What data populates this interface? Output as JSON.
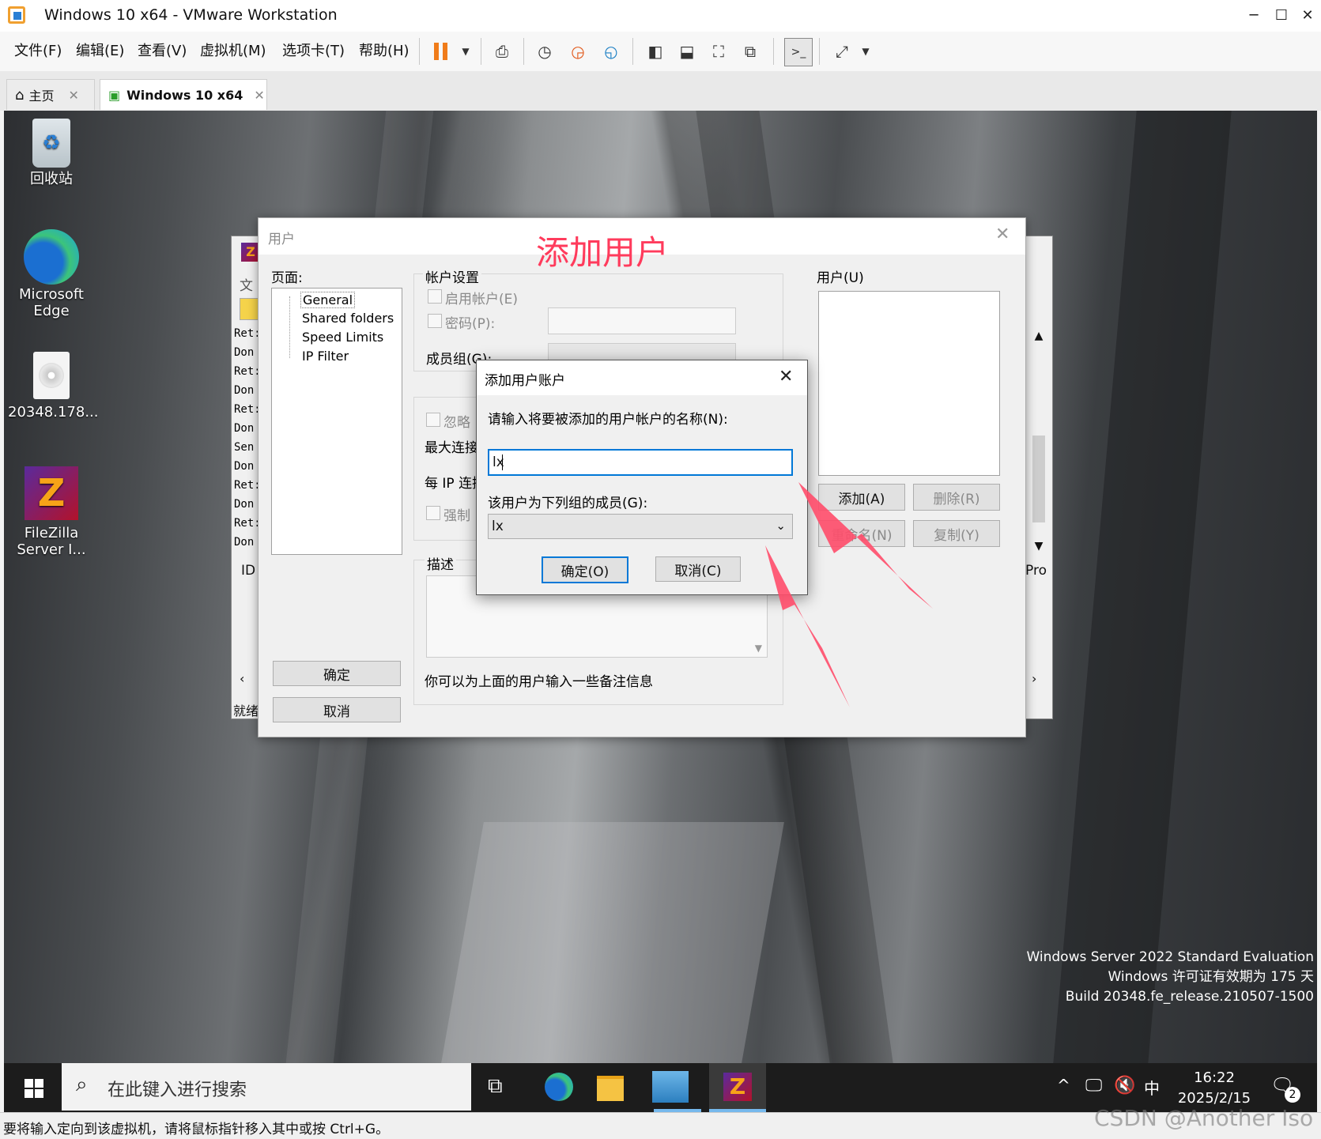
{
  "window": {
    "title": "Windows 10 x64 - VMware Workstation"
  },
  "menu": [
    "文件(F)",
    "编辑(E)",
    "查看(V)",
    "虚拟机(M)",
    "选项卡(T)",
    "帮助(H)"
  ],
  "tabs": [
    {
      "label": "主页"
    },
    {
      "label": "Windows 10 x64"
    }
  ],
  "desktop": {
    "icons": [
      {
        "label": "回收站"
      },
      {
        "label": "Microsoft Edge"
      },
      {
        "label": "20348.178..."
      },
      {
        "label": "FileZilla Server I..."
      }
    ],
    "watermark": [
      "Windows Server 2022 Standard Evaluation",
      "Windows 许可证有效期为 175 天",
      "Build 20348.fe_release.210507-1500"
    ]
  },
  "filezilla_bg": {
    "menu_partial": "文",
    "log_lines": [
      "Ret:",
      "Don",
      "Ret:",
      "Don",
      "Ret:",
      "Don",
      "Sen",
      "Don",
      "Ret:",
      "Don",
      "Ret:",
      "Don"
    ],
    "id_col": "ID",
    "pro_col": "Pro",
    "status_partial": "就绪"
  },
  "users_dialog": {
    "title": "用户",
    "pages_label": "页面:",
    "pages": [
      "General",
      "Shared folders",
      "Speed Limits",
      "IP Filter"
    ],
    "account_settings": "帐户设置",
    "enable_account": "启用帐户(E)",
    "password": "密码(P):",
    "group_member": "成员组(G):",
    "ignore_partial": "忽略",
    "max_conn_partial": "最大连接",
    "per_ip_partial": "每 IP 连接",
    "force_partial": "强制",
    "description": "描述",
    "desc_hint": "你可以为上面的用户输入一些备注信息",
    "users_label": "用户(U)",
    "add": "添加(A)",
    "delete": "删除(R)",
    "rename": "重命名(N)",
    "copy": "复制(Y)",
    "ok": "确定",
    "cancel": "取消"
  },
  "add_dialog": {
    "title": "添加用户账户",
    "prompt": "请输入将要被添加的用户帐户的名称(N):",
    "name_value": "lx",
    "group_prompt": "该用户为下列组的成员(G):",
    "group_value": "lx",
    "ok": "确定(O)",
    "cancel": "取消(C)"
  },
  "annotation": "添加用户",
  "taskbar": {
    "search_placeholder": "在此键入进行搜索",
    "ime": "中",
    "time": "16:22",
    "date": "2025/2/15",
    "notif_count": "2"
  },
  "statusbar": {
    "text": "要将输入定向到该虚拟机，请将鼠标指针移入其中或按 Ctrl+G。"
  },
  "csdn_watermark": "CSDN @Another Iso"
}
